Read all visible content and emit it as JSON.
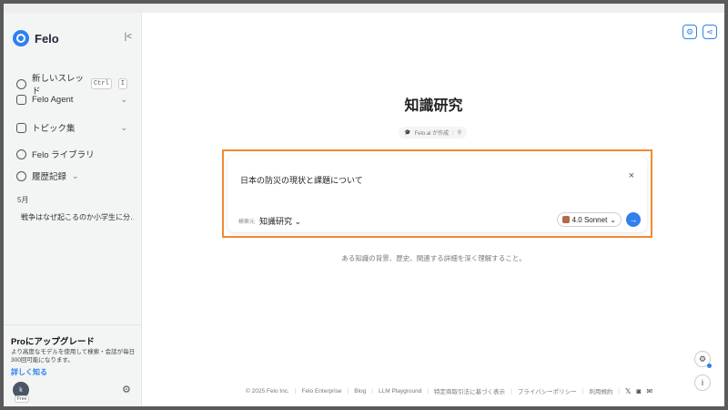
{
  "sidebar": {
    "brand": "Felo",
    "new_thread": "新しいスレッド",
    "shortcut": [
      "Ctrl",
      "I"
    ],
    "items": [
      {
        "label": "Felo Agent"
      },
      {
        "label": "トピック集"
      },
      {
        "label": "Felo ライブラリ"
      },
      {
        "label": "履歴記録"
      }
    ],
    "month": "5月",
    "history_item": "戦争はなぜ起こるのか小学生に分…",
    "upgrade": {
      "title": "Proにアップグレード",
      "description": "より高度なモデルを使用して検索・会話が毎日300回可能になります。",
      "learn_more": "詳しく知る"
    },
    "user_initial": "k",
    "plan_badge": "Free"
  },
  "main": {
    "title": "知識研究",
    "creator": "Felo.ai が作成",
    "query": "日本の防災の現状と課題について",
    "source_label": "検索元",
    "source_value": "知識研究",
    "model": "4.0 Sonnet",
    "description": "ある知識の背景、歴史、関連する詳細を深く理解すること。"
  },
  "footer": {
    "links": [
      "© 2025 Felo Inc.",
      "Felo Enterprise",
      "Blog",
      "LLM Playground",
      "特定商取引法に基づく表示",
      "プライバシーポリシー",
      "利用規約"
    ]
  },
  "colors": {
    "accent": "#2f80ed",
    "highlight_border": "#f28a2e"
  }
}
